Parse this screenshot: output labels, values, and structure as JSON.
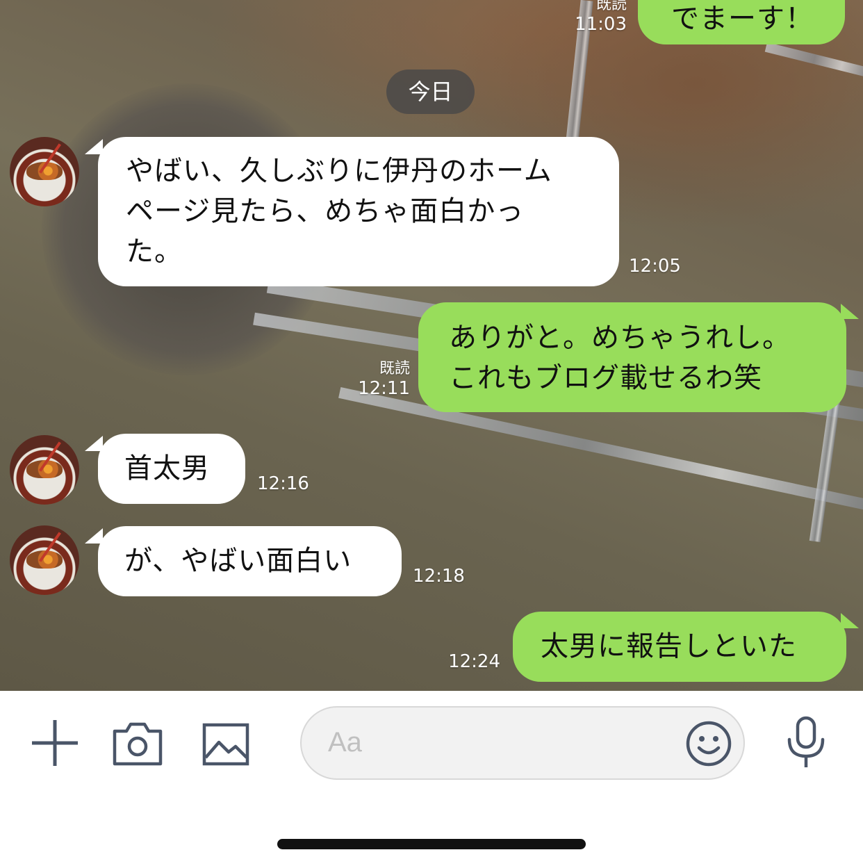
{
  "date_chip": "今日",
  "messages": [
    {
      "side": "out",
      "text": "でまーす！",
      "read": "既読",
      "time": "11:03"
    },
    {
      "side": "in",
      "lines": [
        "やばい、久しぶりに伊丹のホーム",
        "ページ見たら、めちゃ面白かっ",
        "た。"
      ],
      "time": "12:05"
    },
    {
      "side": "out",
      "lines": [
        "ありがと。めちゃうれし。",
        "これもブログ載せるわ笑"
      ],
      "read": "既読",
      "time": "12:11"
    },
    {
      "side": "in",
      "text": "首太男",
      "time": "12:16"
    },
    {
      "side": "in",
      "text": "が、やばい面白い",
      "time": "12:18"
    },
    {
      "side": "out",
      "text": "太男に報告しといた",
      "time": "12:24"
    }
  ],
  "input": {
    "placeholder": "Aa"
  },
  "icons": {
    "plus": "plus-icon",
    "camera": "camera-icon",
    "image": "image-icon",
    "emoji": "emoji-icon",
    "mic": "microphone-icon"
  },
  "colors": {
    "outgoing_bubble": "#98dd5b",
    "incoming_bubble": "#ffffff",
    "icon": "#4a5568"
  }
}
